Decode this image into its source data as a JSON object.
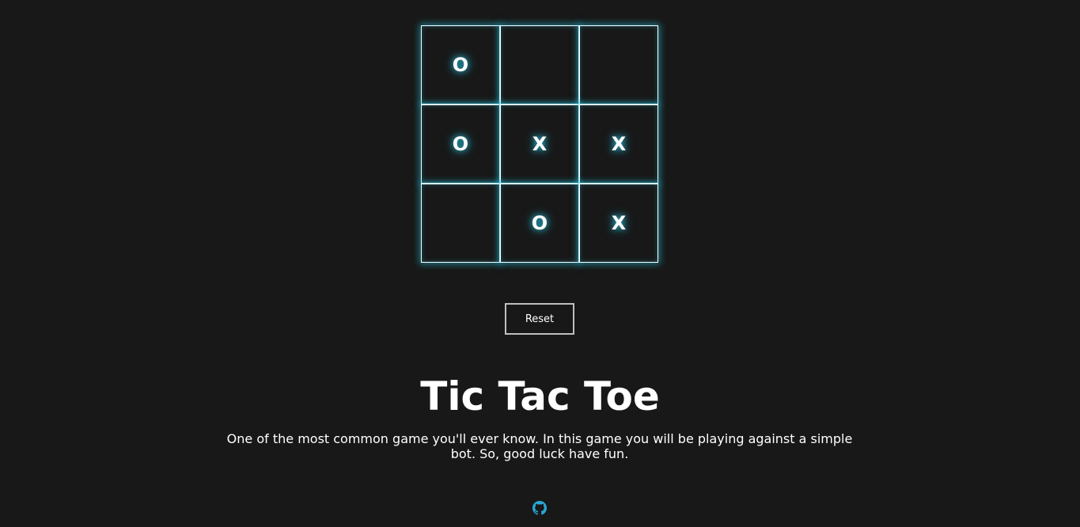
{
  "board": {
    "cells": [
      "O",
      "",
      "",
      "O",
      "X",
      "X",
      "",
      "O",
      "X"
    ]
  },
  "reset_label": "Reset",
  "title": "Tic Tac Toe",
  "description": "One of the most common game you'll ever know. In this game you will be playing against a simple bot. So, good luck have fun.",
  "footer": {
    "icon": "github-icon",
    "icon_color": "#29a8d6"
  },
  "colors": {
    "background": "#181818",
    "glow": "#28c8e6",
    "text": "#ffffff"
  }
}
